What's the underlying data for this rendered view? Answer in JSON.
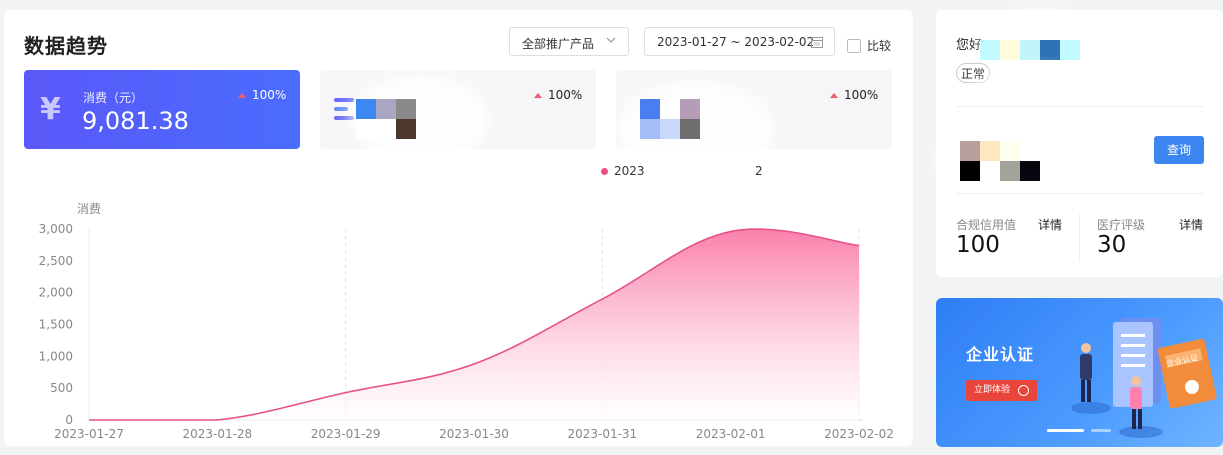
{
  "main": {
    "title": "数据趋势",
    "product_select": {
      "value": "全部推广产品",
      "icon": "chevron-down-icon"
    },
    "date_range": {
      "value": "2023-01-27 ~ 2023-02-02",
      "icon": "calendar-icon"
    },
    "compare_label": "比较",
    "compare_checked": false
  },
  "stats": [
    {
      "icon": "yen-icon",
      "icon_glyph": "¥",
      "label": "消费（元）",
      "value": "9,081.38",
      "change": "100%"
    },
    {
      "icon": "bars-icon",
      "label": "",
      "value": "",
      "change": "100%"
    },
    {
      "icon": "redacted-icon",
      "label": "",
      "value": "",
      "change": "100%"
    }
  ],
  "legend": {
    "left_text": "2023",
    "right_text": "2"
  },
  "chart_data": {
    "type": "area",
    "ylabel": "消费",
    "xlabel": "",
    "x": [
      "2023-01-27",
      "2023-01-28",
      "2023-01-29",
      "2023-01-30",
      "2023-01-31",
      "2023-02-01",
      "2023-02-02"
    ],
    "y_ticks": [
      "0",
      "500",
      "1,000",
      "1,500",
      "2,000",
      "2,500",
      "3,000"
    ],
    "ylim": [
      0,
      3000
    ],
    "series": [
      {
        "values": [
          0,
          0,
          430,
          880,
          1900,
          2960,
          2740
        ]
      }
    ],
    "grid": "vertical-dashed",
    "colors": {
      "line": "#e8508a",
      "fill_top": "#fb7fab",
      "fill_bottom": "#ffffff"
    }
  },
  "side": {
    "greeting": "您好",
    "status_pill": "正常",
    "query_button": "查询",
    "metrics": [
      {
        "label": "合规信用值",
        "detail": "详情",
        "value": "100"
      },
      {
        "label": "医疗评级",
        "detail": "详情",
        "value": "30"
      }
    ]
  },
  "banner": {
    "title": "企业认证",
    "button": "立即体验",
    "badge": "企业认证"
  },
  "colors": {
    "accent": "#4a6cff",
    "query": "#3c86f2",
    "up_arrow": "#f25a6b",
    "banner_button": "#e8453c"
  }
}
